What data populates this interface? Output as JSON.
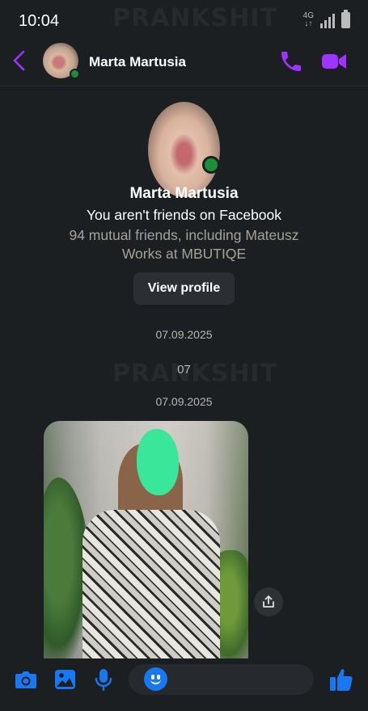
{
  "status_bar": {
    "time": "10:04",
    "network": "4G",
    "watermark": "PRANKSHIT"
  },
  "header": {
    "contact_name": "Marta Martusia"
  },
  "profile": {
    "name": "Marta Martusia",
    "friend_status": "You aren't friends on Facebook",
    "mutual_friends": "94 mutual friends, including Mateusz",
    "work": "Works at MBUTIQE",
    "view_profile_label": "View profile"
  },
  "thread": {
    "date1": "07.09.2025",
    "message_text": "07",
    "date2": "07.09.2025"
  },
  "colors": {
    "background": "#1c1f22",
    "accent_purple": "#a033ff",
    "composer_blue": "#1877f2",
    "online_green": "#1d8f3a"
  },
  "icons": [
    "back-arrow-icon",
    "phone-icon",
    "video-camera-icon",
    "camera-icon",
    "gallery-icon",
    "microphone-icon",
    "emoji-icon",
    "thumbs-up-icon",
    "share-icon"
  ]
}
